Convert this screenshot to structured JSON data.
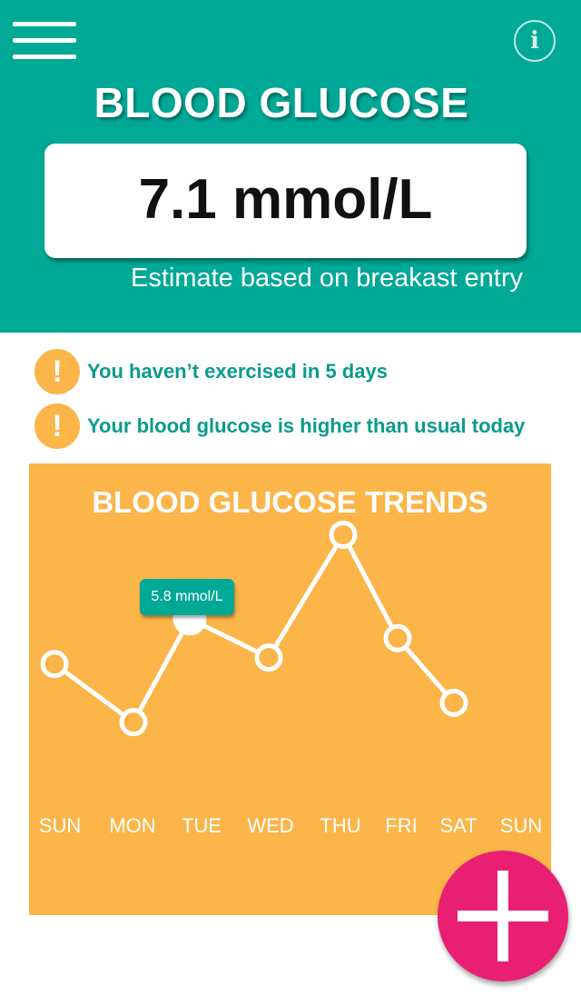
{
  "header": {
    "title": "BLOOD GLUCOSE",
    "reading": "7.1 mmol/L",
    "estimate_note": "Estimate based on breakast entry",
    "menu_icon": "hamburger-menu-icon",
    "info_icon": "info-icon",
    "info_glyph": "i",
    "background_color": "#00a896"
  },
  "alerts": [
    {
      "icon": "exclamation-icon",
      "glyph": "!",
      "text": "You haven’t exercised in 5 days"
    },
    {
      "icon": "exclamation-icon",
      "glyph": "!",
      "text": "Your blood glucose is higher than usual today"
    }
  ],
  "trends": {
    "title": "BLOOD GLUCOSE TRENDS",
    "panel_color": "#fbb549",
    "tooltip": "5.8 mmol/L"
  },
  "chart_data": {
    "type": "line",
    "categories": [
      "SUN",
      "MON",
      "TUE",
      "WED",
      "THU",
      "FRI",
      "SAT",
      "SUN"
    ],
    "values": [
      5.1,
      4.2,
      5.8,
      5.2,
      7.1,
      5.5,
      4.5,
      null
    ],
    "highlighted_index": 2,
    "ylim": [
      3.0,
      7.5
    ],
    "grid": false,
    "line_color": "#ffffff"
  },
  "fab": {
    "icon": "plus-icon",
    "color": "#e91f73"
  }
}
